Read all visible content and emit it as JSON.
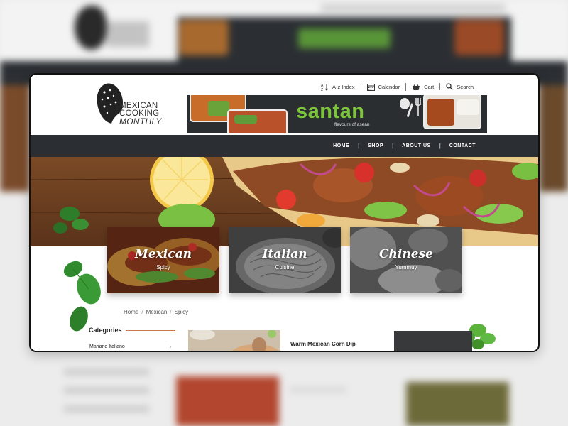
{
  "site": {
    "logo": {
      "line1": "MEXICAN",
      "line2": "COOKING",
      "line3": "MONTHLY"
    },
    "top_links": [
      {
        "label": "A-z Index",
        "icon": "az-sort-icon"
      },
      {
        "label": "Calendar",
        "icon": "calendar-icon"
      },
      {
        "label": "Cart",
        "icon": "basket-icon"
      },
      {
        "label": "Search",
        "icon": "search-icon"
      }
    ],
    "banner": {
      "brand": "santan",
      "tagline": "flavours of asean"
    },
    "nav": [
      {
        "label": "HOME"
      },
      {
        "label": "SHOP"
      },
      {
        "label": "ABOUT US"
      },
      {
        "label": "CONTACT"
      }
    ]
  },
  "categories_cards": [
    {
      "title": "Mexican",
      "subtitle": "Spicy"
    },
    {
      "title": "Italian",
      "subtitle": "Cuisine"
    },
    {
      "title": "Chinese",
      "subtitle": "Yummuy"
    }
  ],
  "breadcrumb": [
    "Home",
    "Mexican",
    "Spicy"
  ],
  "sidebar": {
    "title": "Categories",
    "items": [
      {
        "label": "Mariano Italiano"
      }
    ]
  },
  "posts": [
    {
      "title": "Warm Mexican Corn Dip"
    }
  ],
  "colors": {
    "nav_bg": "#2b2f33",
    "brand_green": "#7cc53a",
    "accent_rule": "#c97b4b"
  }
}
